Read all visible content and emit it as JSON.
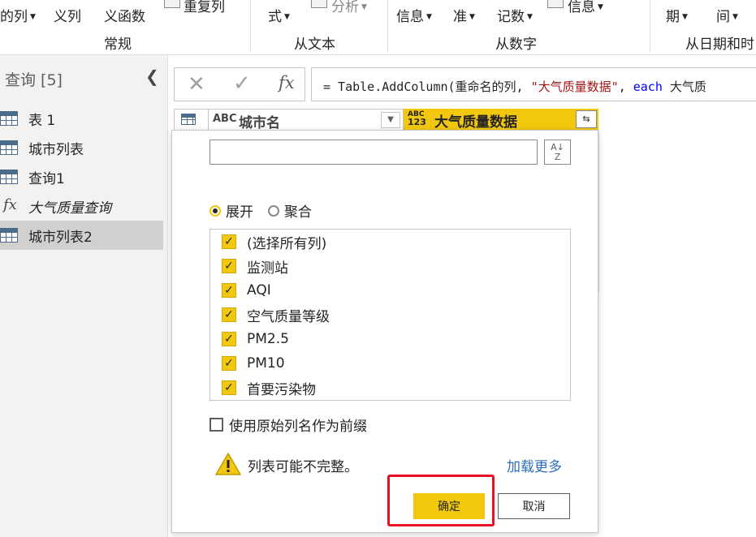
{
  "ribbon": {
    "partial_labels": {
      "custom_col": "的列",
      "custom_col2": "义列",
      "custom_func": "义函数",
      "dup_col": "重复列",
      "format": "式",
      "parse": "分析",
      "info1": "信息",
      "standard": "准",
      "sci": "记数",
      "info2": "信息",
      "date": "期",
      "time": "间"
    },
    "groups": {
      "general": "常规",
      "from_text": "从文本",
      "from_number": "从数字",
      "from_datetime": "从日期和时"
    }
  },
  "queries": {
    "title": "查询 [5]",
    "items": [
      {
        "label": "表 1",
        "icon": "table-icon",
        "italic": false,
        "selected": false
      },
      {
        "label": "城市列表",
        "icon": "table-icon",
        "italic": false,
        "selected": false
      },
      {
        "label": "查询1",
        "icon": "table-icon",
        "italic": false,
        "selected": false
      },
      {
        "label": "大气质量查询",
        "icon": "function-icon",
        "italic": true,
        "selected": false
      },
      {
        "label": "城市列表2",
        "icon": "table-icon",
        "italic": false,
        "selected": true
      }
    ]
  },
  "formula_bar": {
    "cancel_glyph": "✕",
    "commit_glyph": "✓",
    "fx_glyph": "fx",
    "prefix": "= Table.AddColumn(重命名的列, ",
    "string": "\"大气质量数据\"",
    "sep": ", ",
    "keyword": "each",
    "rest": " 大气质"
  },
  "grid": {
    "col1": {
      "type": "ABC",
      "name": "城市名"
    },
    "col2": {
      "type_top": "ABC",
      "type_bottom": "123",
      "name": "大气质量数据"
    }
  },
  "expand_popup": {
    "search_placeholder": "",
    "sort_label_top": "A",
    "sort_label_bottom": "Z",
    "radio_expand": "展开",
    "radio_aggregate": "聚合",
    "columns": [
      {
        "label": "(选择所有列)",
        "checked": true
      },
      {
        "label": "监测站",
        "checked": true
      },
      {
        "label": "AQI",
        "checked": true
      },
      {
        "label": "空气质量等级",
        "checked": true
      },
      {
        "label": "PM2.5",
        "checked": true
      },
      {
        "label": "PM10",
        "checked": true
      },
      {
        "label": "首要污染物",
        "checked": true
      }
    ],
    "prefix_option": "使用原始列名作为前缀",
    "warning": "列表可能不完整。",
    "load_more": "加载更多",
    "ok": "确定",
    "cancel": "取消"
  },
  "colors": {
    "accent": "#f2c80f",
    "highlight_box": "#e81123",
    "link": "#2c6fb8"
  }
}
